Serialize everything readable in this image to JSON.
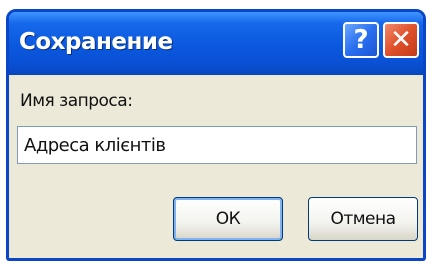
{
  "dialog": {
    "title": "Сохранение",
    "help_label": "?",
    "close_label": "✕"
  },
  "form": {
    "label": "Имя запроса:",
    "value": "Адреса клієнтів"
  },
  "buttons": {
    "ok": "ОК",
    "cancel": "Отмена"
  }
}
